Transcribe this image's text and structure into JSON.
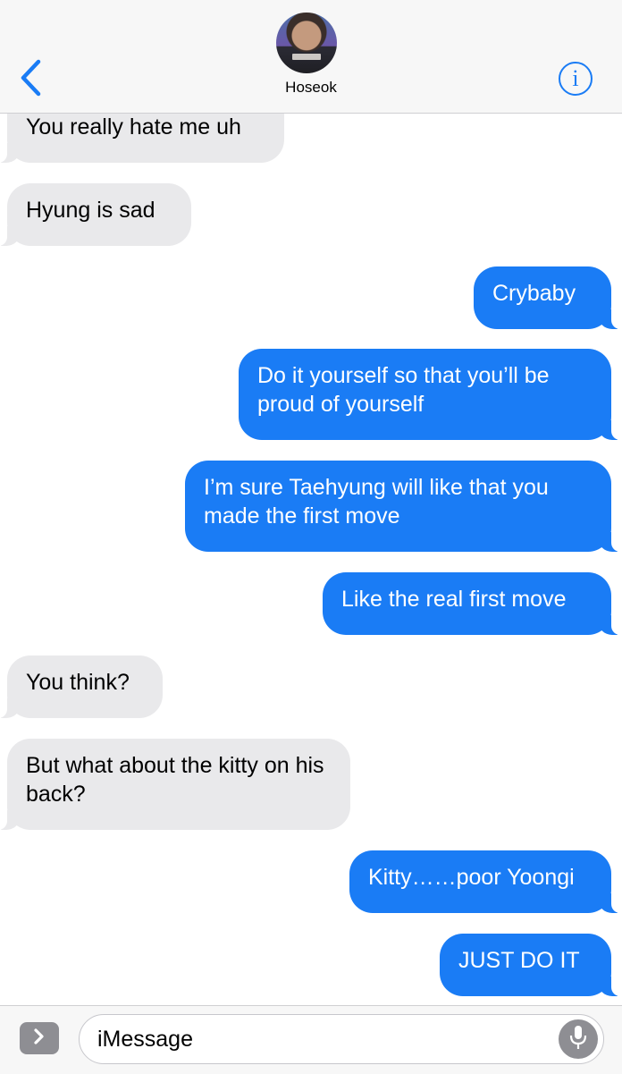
{
  "header": {
    "contact_name": "Hoseok",
    "info_label": "i"
  },
  "messages": [
    {
      "dir": "in",
      "text": "You really hate me uh"
    },
    {
      "dir": "in",
      "text": "Hyung is sad"
    },
    {
      "dir": "out",
      "text": "Crybaby"
    },
    {
      "dir": "out",
      "text": "Do it yourself so that you’ll be proud of yourself"
    },
    {
      "dir": "out",
      "text": "I’m sure Taehyung will like that you made the first move"
    },
    {
      "dir": "out",
      "text": "Like the real first move"
    },
    {
      "dir": "in",
      "text": "You think?"
    },
    {
      "dir": "in",
      "text": "But what about the kitty on his back?"
    },
    {
      "dir": "out",
      "text": "Kitty……poor Yoongi"
    },
    {
      "dir": "out",
      "text": "JUST DO IT"
    }
  ],
  "composer": {
    "placeholder": "iMessage"
  },
  "colors": {
    "accent": "#1a7cf5",
    "incoming_bubble": "#e9e9eb",
    "outgoing_bubble": "#1a7cf5"
  },
  "icons": [
    "chevron-left-icon",
    "info-icon",
    "chevron-right-icon",
    "microphone-icon"
  ]
}
